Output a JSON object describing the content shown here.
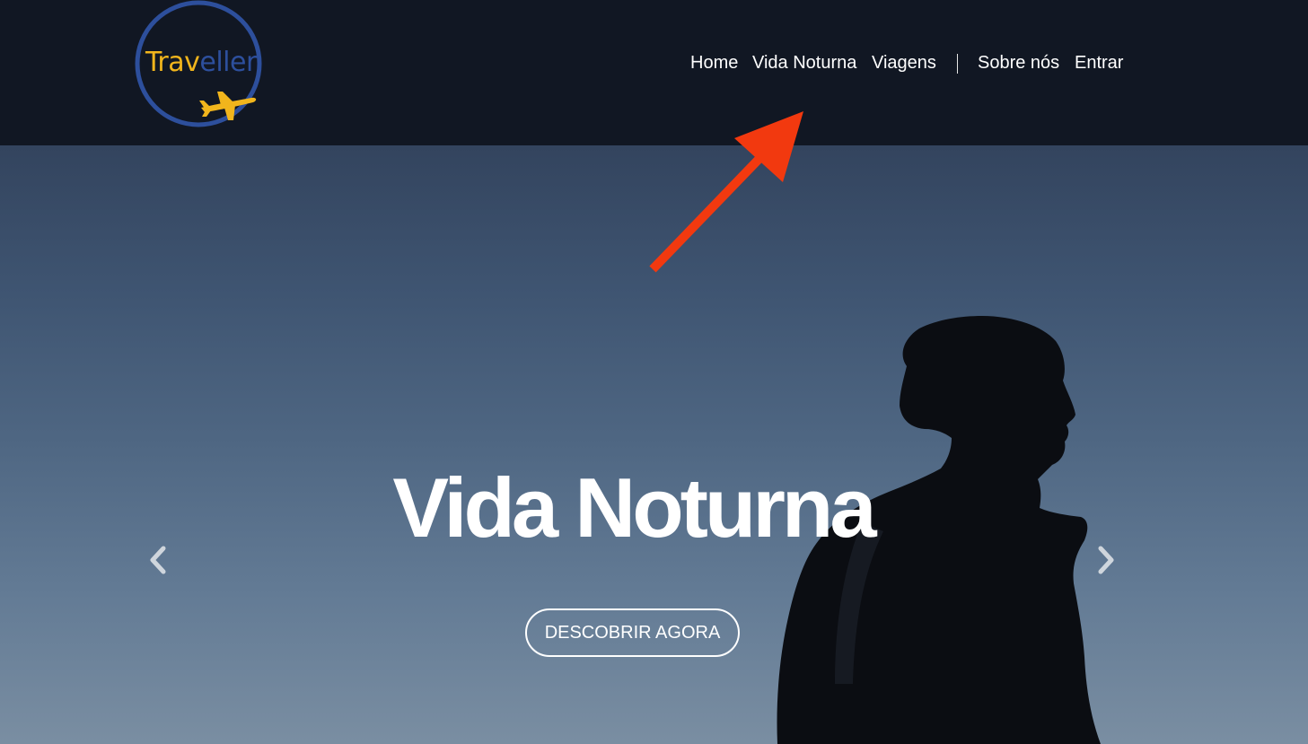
{
  "header": {
    "logo": {
      "text_part1": "Trav",
      "text_part2": "eller",
      "icon": "airplane-icon",
      "ring_color": "#2d4f9c",
      "accent_color": "#f1b51c"
    },
    "nav": {
      "home": "Home",
      "nightlife": "Vida Noturna",
      "trips": "Viagens",
      "about": "Sobre nós",
      "login": "Entrar"
    }
  },
  "hero": {
    "title": "Vida Noturna",
    "cta_label": "DESCOBRIR AGORA",
    "prev_icon": "chevron-left-icon",
    "next_icon": "chevron-right-icon"
  },
  "annotation": {
    "type": "red-arrow",
    "color": "#f2390f"
  },
  "colors": {
    "header_bg": "#111723",
    "text": "#ffffff"
  }
}
